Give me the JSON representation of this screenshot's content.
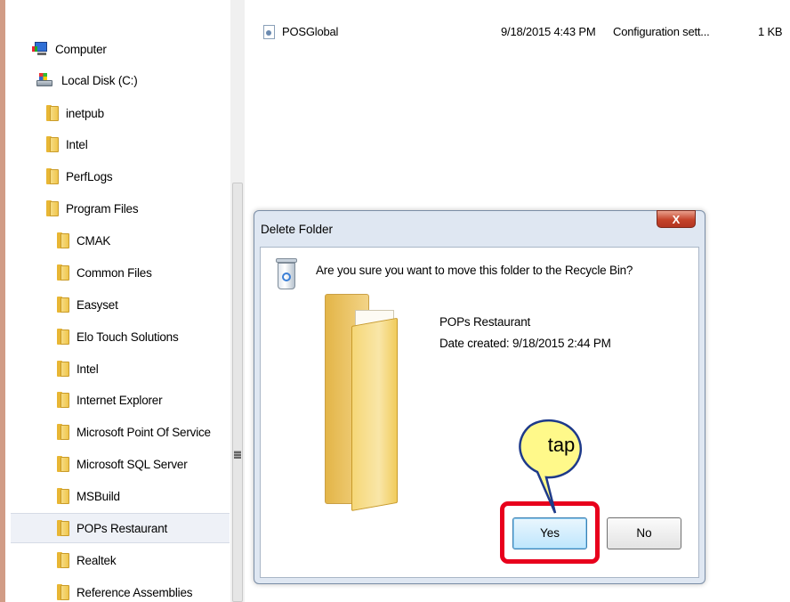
{
  "nav_tree": [
    {
      "label": "Computer",
      "icon": "computer-icon"
    },
    {
      "label": "Local Disk (C:)",
      "icon": "local-disk-icon"
    },
    {
      "label": "inetpub",
      "icon": "folder-icon"
    },
    {
      "label": "Intel",
      "icon": "folder-icon"
    },
    {
      "label": "PerfLogs",
      "icon": "folder-icon"
    },
    {
      "label": "Program Files",
      "icon": "folder-icon"
    },
    {
      "label": "CMAK",
      "icon": "folder-icon"
    },
    {
      "label": "Common Files",
      "icon": "folder-icon"
    },
    {
      "label": "Easyset",
      "icon": "folder-icon"
    },
    {
      "label": "Elo Touch Solutions",
      "icon": "folder-icon"
    },
    {
      "label": "Intel",
      "icon": "folder-icon"
    },
    {
      "label": "Internet Explorer",
      "icon": "folder-icon"
    },
    {
      "label": "Microsoft Point Of Service",
      "icon": "folder-icon"
    },
    {
      "label": "Microsoft SQL Server",
      "icon": "folder-icon"
    },
    {
      "label": "MSBuild",
      "icon": "folder-icon"
    },
    {
      "label": "POPs Restaurant",
      "icon": "folder-icon",
      "selected": true
    },
    {
      "label": "Realtek",
      "icon": "folder-icon"
    },
    {
      "label": "Reference Assemblies",
      "icon": "folder-icon"
    }
  ],
  "file_list": {
    "rows": [
      {
        "name": "POSGlobal",
        "date": "9/18/2015 4:43 PM",
        "type": "Configuration sett...",
        "size": "1 KB"
      }
    ]
  },
  "dialog": {
    "title": "Delete Folder",
    "close_label": "X",
    "message": "Are you sure you want to move this folder to the Recycle Bin?",
    "folder_name": "POPs Restaurant",
    "date_created": "Date created: 9/18/2015 2:44 PM",
    "yes_label": "Yes",
    "no_label": "No"
  },
  "annotation": {
    "callout_text": "tap",
    "callout_color": "#fff98a",
    "highlight_color": "#e8001c"
  },
  "colors": {
    "page_edge": "#d19c86",
    "dialog_frame": "#dfe7f2",
    "close_button": "#c4432a",
    "selection": "#eef1f7"
  }
}
